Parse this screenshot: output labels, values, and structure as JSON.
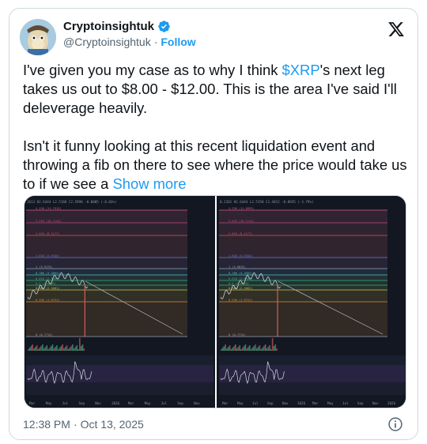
{
  "author": {
    "display_name": "Cryptoinsightuk",
    "handle": "@Cryptoinsightuk",
    "separator": "·",
    "follow_label": "Follow"
  },
  "tweet": {
    "p1_before": "I've given you my case as to why I think ",
    "cashtag": "$XRP",
    "p1_after": "'s next leg takes us out to $8.00 - $12.00. This is the area I've said I'll deleverage heavily.",
    "p2": "Isn't it funny looking at this recent liquidation event and throwing a fib on there to see where the price would take us to if we see a ",
    "show_more": "Show more"
  },
  "timestamp": {
    "time": "12:38 PM",
    "separator": "·",
    "date": "Oct 13, 2025"
  },
  "colors": {
    "link": "#1d9bf0",
    "verified": "#1d9bf0",
    "chart_bg": "#131722"
  },
  "icons": [
    "verified-badge-icon",
    "x-logo-icon",
    "info-icon"
  ],
  "charts": {
    "left": {
      "header": "1613 H2.6444 L2.5160 C2.5998 -0.0005 (-0.03%)",
      "fib_labels": [
        "4.236 (11.7913)",
        "3.618 (10.1144)",
        "2.618 (8.1177)",
        "1.618 (5.5344)",
        "1 (3.9175)",
        "0.786 (3.3663)",
        "0.618 (2.9389)",
        "0.5 (2.6425)",
        "0.382 (2.3461)",
        "0.236 (1.9731)",
        "0 (0.7713)"
      ],
      "x_labels": [
        "Mar",
        "May",
        "Jul",
        "Sep",
        "Nov",
        "2026",
        "Mar",
        "May",
        "Jul",
        "Sep",
        "Nov"
      ]
    },
    "right": {
      "header": "0.2201 H2.6444 L2.5150 C2.4812 -0.0935 (-3.79%)",
      "fib_labels": [
        "4.236 (11.0993)",
        "3.618 (10.1144)",
        "2.618 (8.1177)",
        "1.618 (5.5344)",
        "1 (3.6815)",
        "0.786 (3.3563)",
        "0.618 (2.9389)",
        "0.5 (2.6425)",
        "0.382 (2.3461)",
        "0.236 (1.9731)",
        "0 (0.7713)"
      ],
      "x_labels": [
        "Mar",
        "May",
        "Jul",
        "Sep",
        "Nov",
        "2026",
        "Mar",
        "May",
        "Jul",
        "Sep",
        "Nov",
        "2026"
      ]
    }
  }
}
